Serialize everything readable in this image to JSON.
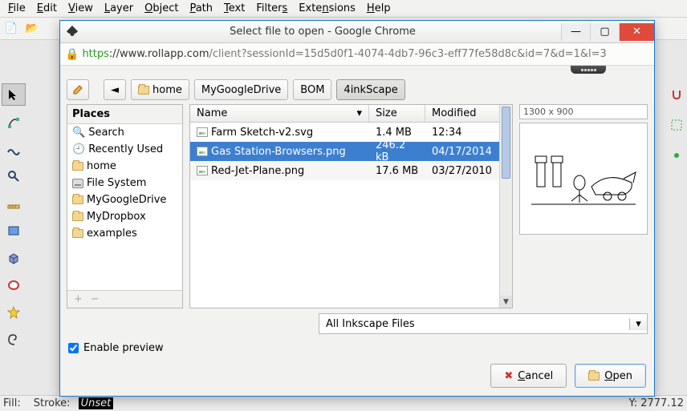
{
  "menubar": {
    "file": "File",
    "edit": "Edit",
    "view": "View",
    "layer": "Layer",
    "object": "Object",
    "path": "Path",
    "text": "Text",
    "filters": "Filters",
    "extensions": "Extensions",
    "help": "Help"
  },
  "status": {
    "fill": "Fill:",
    "stroke": "Stroke:",
    "unset": "Unset",
    "coord": "Y: 2777.12"
  },
  "dialog": {
    "title": "Select file to open - Google Chrome",
    "url_proto": "https",
    "url_host": "://www.rollapp.com",
    "url_rest": "/client?sessionId=15d5d0f1-4074-4db7-96c3-eff77fe58d8c&id=7&d=1&l=3",
    "path": {
      "home": "home",
      "crumb1": "MyGoogleDrive",
      "crumb2": "BOM",
      "crumb3": "4inkScape"
    },
    "places": {
      "header": "Places",
      "items": [
        "Search",
        "Recently Used",
        "home",
        "File System",
        "MyGoogleDrive",
        "MyDropbox",
        "examples"
      ]
    },
    "filelist": {
      "cols": {
        "name": "Name",
        "size": "Size",
        "mod": "Modified"
      },
      "rows": [
        {
          "name": "Farm Sketch-v2.svg",
          "size": "1.4 MB",
          "mod": "12:34"
        },
        {
          "name": "Gas Station-Browsers.png",
          "size": "246.2 kB",
          "mod": "04/17/2014"
        },
        {
          "name": "Red-Jet-Plane.png",
          "size": "17.6 MB",
          "mod": "03/27/2010"
        }
      ]
    },
    "preview_dim": "1300 x 900",
    "filter": "All Inkscape Files",
    "enable_preview": "Enable preview",
    "buttons": {
      "cancel": "Cancel",
      "open": "Open"
    }
  }
}
